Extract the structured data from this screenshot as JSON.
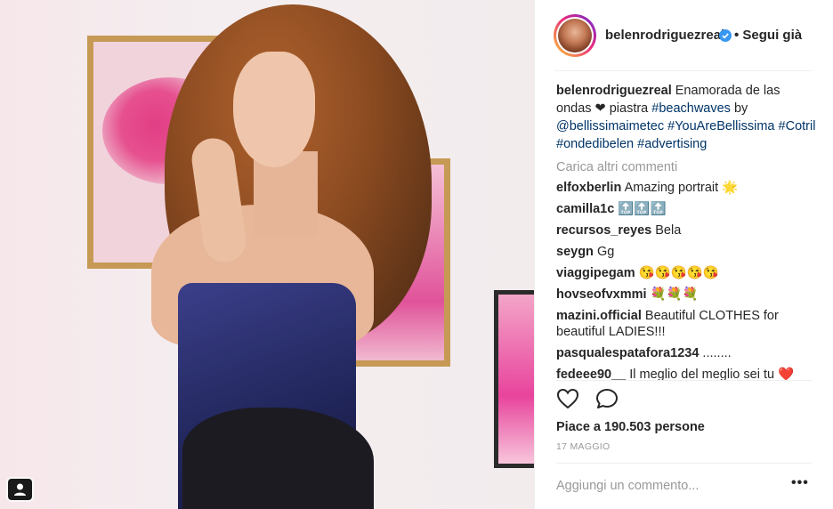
{
  "post": {
    "username": "belenrodriguezreal",
    "follow_status": "• Segui già"
  },
  "caption": {
    "username": "belenrodriguezreal",
    "text1": " Enamorada de las ondas ❤ piastra ",
    "tag_beachwaves": "#beachwaves",
    "text2": " by ",
    "mention": "@bellissimaimetec",
    "tag_youarebellissima": "#YouAreBellissima",
    "tag_cotril": "#Cotril",
    "tag_ondedibelen": "#ondedibelen",
    "tag_advertising": "#advertising"
  },
  "load_more": "Carica altri commenti",
  "comments": [
    {
      "user": "elfoxberlin",
      "text": "Amazing portrait 🌟"
    },
    {
      "user": "camilla1c",
      "text": "🔝🔝🔝"
    },
    {
      "user": "recursos_reyes",
      "text": "Bela"
    },
    {
      "user": "seygn",
      "text": "Gg"
    },
    {
      "user": "viaggipegam",
      "text": "😘😘😘😘😘"
    },
    {
      "user": "hovseofvxmmi",
      "text": "💐💐💐"
    },
    {
      "user": "mazini.official",
      "text": "Beautiful CLOTHES for beautiful LADIES!!!"
    },
    {
      "user": "pasqualespatafora1234",
      "text": "........"
    },
    {
      "user": "fedeee90__",
      "text": "Il meglio del meglio sei tu ❤️"
    }
  ],
  "likes": "Piace a 190.503 persone",
  "date": "17 MAGGIO",
  "comment_input": {
    "placeholder": "Aggiungi un commento..."
  },
  "more_options": "•••",
  "icons": {
    "like": "heart-outline-icon",
    "comment": "speech-bubble-icon",
    "verified": "verified-badge-icon",
    "carousel": "tagged-user-icon"
  },
  "colors": {
    "link": "#003569",
    "verified": "#3897f0",
    "muted": "#999999"
  }
}
